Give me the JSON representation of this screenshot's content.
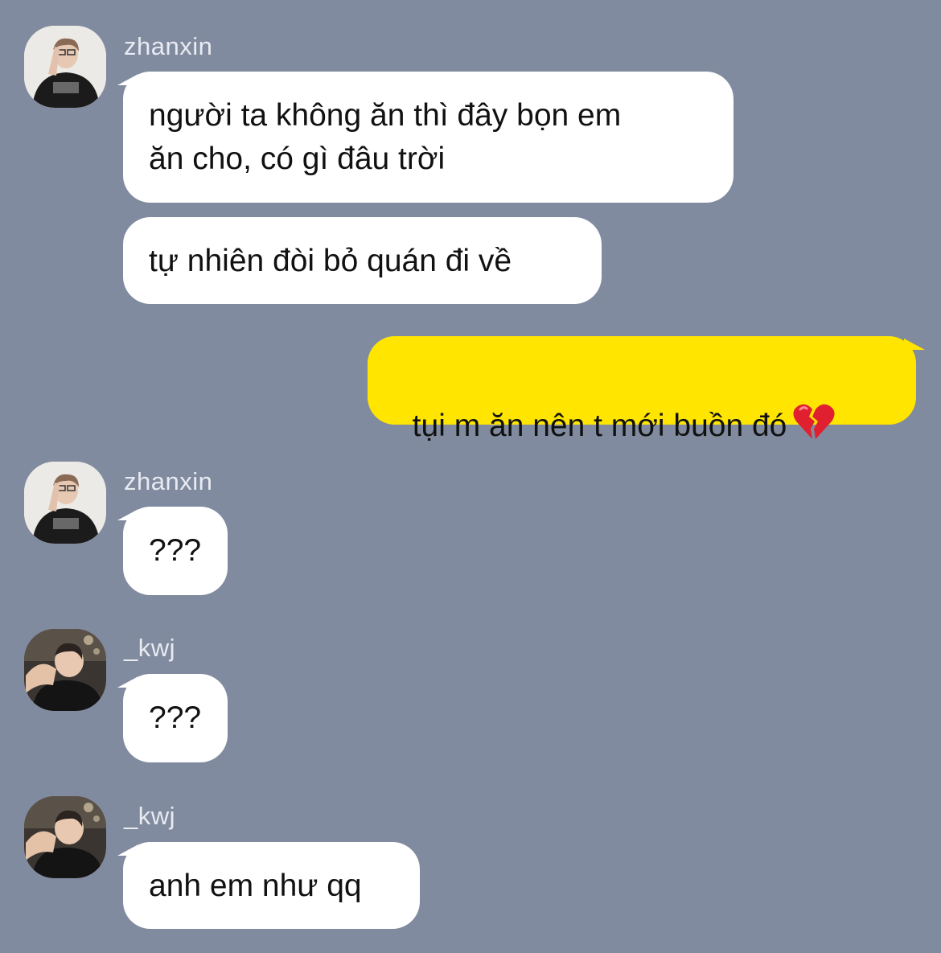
{
  "messages": [
    {
      "sender": "zhanxin",
      "text": "người ta không ăn thì đây bọn em\năn cho, có gì đâu trời"
    },
    {
      "sender": "zhanxin",
      "text": "tự nhiên đòi bỏ quán đi về"
    },
    {
      "sender": "me",
      "text": "tụi m ăn nên t mới buồn đó",
      "emoji": "broken-heart-icon"
    },
    {
      "sender": "zhanxin",
      "text": "???"
    },
    {
      "sender": "_kwj",
      "text": "???"
    },
    {
      "sender": "_kwj",
      "text": "anh em như qq"
    }
  ],
  "groups": [
    {
      "name": "zhanxin"
    },
    {
      "name": "zhanxin"
    },
    {
      "name": "_kwj"
    },
    {
      "name": "_kwj"
    }
  ],
  "colors": {
    "background": "#818b9f",
    "incoming_bubble": "#ffffff",
    "outgoing_bubble": "#ffe500"
  }
}
